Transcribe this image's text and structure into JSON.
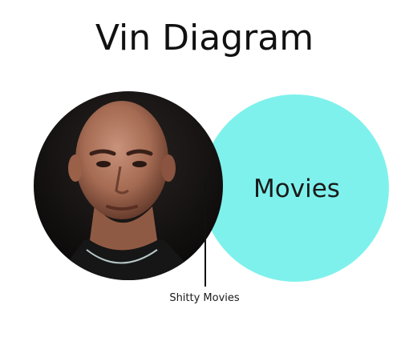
{
  "title": "Vin Diagram",
  "circles": {
    "left": {
      "content": "photo-portrait",
      "description_icon": "person-portrait-icon"
    },
    "right": {
      "label": "Movies",
      "fill_color": "#7ff1ec"
    }
  },
  "intersection": {
    "label": "Shitty Movies"
  },
  "colors": {
    "background": "#ffffff",
    "text": "#111111",
    "movies_circle": "#7ff1ec",
    "leader_line": "#111111"
  }
}
